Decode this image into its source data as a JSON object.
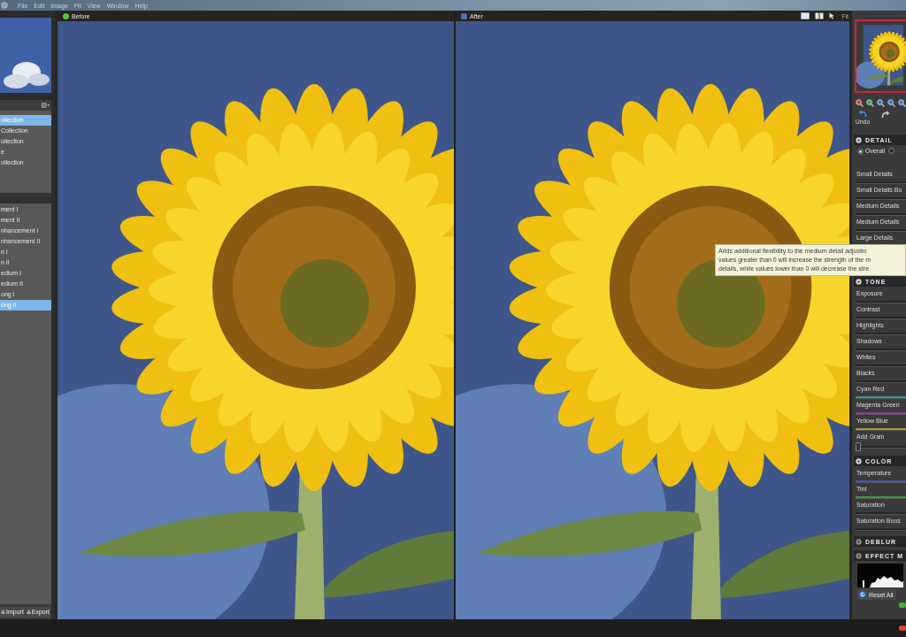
{
  "menu_bar": {
    "items": [
      "File",
      "Edit",
      "Image",
      "Fit",
      "View",
      "Window",
      "Help"
    ]
  },
  "left_panel": {
    "collections": [
      {
        "label": "ollection",
        "selected": true
      },
      {
        "label": "Collection",
        "selected": false
      },
      {
        "label": "ollection",
        "selected": false
      },
      {
        "label": "e",
        "selected": false
      },
      {
        "label": "ollection",
        "selected": false
      }
    ],
    "presets": [
      {
        "label": "ment I",
        "selected": false
      },
      {
        "label": "ment II",
        "selected": false
      },
      {
        "label": "nhancement I",
        "selected": false
      },
      {
        "label": "nhancement II",
        "selected": false
      },
      {
        "label": "n I",
        "selected": false
      },
      {
        "label": "n II",
        "selected": false
      },
      {
        "label": "edium I",
        "selected": false
      },
      {
        "label": "edium II",
        "selected": false
      },
      {
        "label": "ong I",
        "selected": false
      },
      {
        "label": "ong II",
        "selected": true
      }
    ],
    "buttons": [
      "Import",
      "Export"
    ]
  },
  "panes": [
    {
      "title": "Before",
      "kind": "before"
    },
    {
      "title": "After",
      "kind": "after",
      "zoom_label": "Fit"
    }
  ],
  "tooltip": {
    "lines": [
      "Adds additional flexibility to the medium detail adjustm",
      "values greater than 0 will increase the strength of the m",
      "details, while values lower than 0 will decrease the stre"
    ]
  },
  "right_panel": {
    "undo_label": "Undo",
    "sections": [
      {
        "title": "DETAIL",
        "expanded": true,
        "radios": [
          {
            "label": "Overall",
            "selected": true
          },
          {
            "selected": false
          }
        ],
        "sliders": [
          {
            "label": "Small Details"
          },
          {
            "label": "Small Details Bo"
          },
          {
            "label": "Medium Details"
          },
          {
            "label": "Medium Details"
          },
          {
            "label": "Large Details"
          }
        ]
      },
      {
        "title": "TONE",
        "expanded": true,
        "sliders": [
          {
            "label": "Exposure"
          },
          {
            "label": "Contrast"
          },
          {
            "label": "Highlights"
          },
          {
            "label": "Shadows"
          },
          {
            "label": "Whites"
          },
          {
            "label": "Blacks"
          },
          {
            "label": "Cyan Red",
            "color": "#2f9a9a"
          },
          {
            "label": "Magenta Green",
            "color": "#8b3c9c"
          },
          {
            "label": "Yellow Blue",
            "color": "#a39a34"
          },
          {
            "label": "Add Grain",
            "level": 0
          }
        ]
      },
      {
        "title": "COLOR",
        "expanded": true,
        "sliders": [
          {
            "label": "Temperature",
            "color": "#3a55b8"
          },
          {
            "label": "Tint",
            "color": "#3f9a45"
          },
          {
            "label": "Saturation"
          },
          {
            "label": "Saturation Boos"
          }
        ]
      },
      {
        "title": "DEBLUR",
        "expanded": false
      },
      {
        "title": "EFFECT M",
        "expanded": false
      }
    ],
    "reset_button": "Reset All"
  }
}
